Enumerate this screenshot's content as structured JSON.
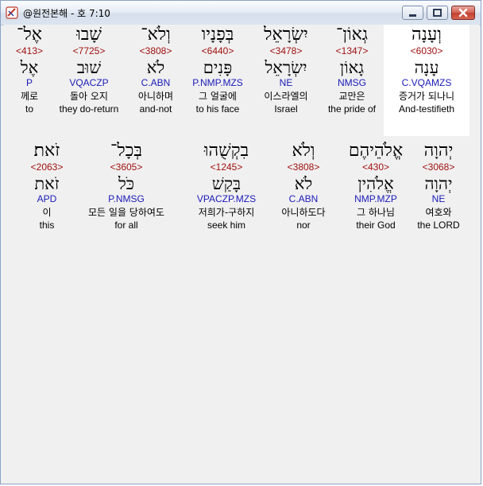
{
  "window": {
    "title": "@원전본해 - 호 7:10",
    "minimize_icon": "minimize-icon",
    "maximize_icon": "maximize-icon",
    "close_icon": "close-icon"
  },
  "rows": [
    {
      "words": [
        {
          "hebrew": "וְעָנָה",
          "strong": "<6030>",
          "lemma": "עָנָה",
          "parse": "C.VQAMZS",
          "korean": "증거가 되나니",
          "english": "And-testifieth",
          "highlight": true
        },
        {
          "hebrew": "גְאוֹן־",
          "strong": "<1347>",
          "lemma": "גָאוֹן",
          "parse": "NMSG",
          "korean": "교만은",
          "english": "the pride of"
        },
        {
          "hebrew": "יִשְׂרָאֵל",
          "strong": "<3478>",
          "lemma": "יִשְׂרָאֵל",
          "parse": "NE",
          "korean": "이스라엘의",
          "english": "Israel"
        },
        {
          "hebrew": "בְּפָנָיו",
          "strong": "<6440>",
          "lemma": "פָּנִים",
          "parse": "P.NMP.MZS",
          "korean": "그 얼굴에",
          "english": "to his face"
        },
        {
          "hebrew": "וְלֹא־",
          "strong": "<3808>",
          "lemma": "לֹא",
          "parse": "C.ABN",
          "korean": "아니하며",
          "english": "and-not"
        },
        {
          "hebrew": "שָׁבוּ",
          "strong": "<7725>",
          "lemma": "שׁוּב",
          "parse": "VQACZP",
          "korean": "돌아 오지",
          "english": "they do-return"
        },
        {
          "hebrew": "אֶל־",
          "strong": "<413>",
          "lemma": "אֶל",
          "parse": "P",
          "korean": "께로",
          "english": "to"
        }
      ]
    },
    {
      "words": [
        {
          "hebrew": "יְהוָה",
          "strong": "<3068>",
          "lemma": "יְהוָה",
          "parse": "NE",
          "korean": "여호와",
          "english": "the LORD"
        },
        {
          "hebrew": "אֱלֹהֵיהֶם",
          "strong": "<430>",
          "lemma": "אֱלֹהִין",
          "parse": "NMP.MZP",
          "korean": "그 하나님",
          "english": "their God"
        },
        {
          "hebrew": "וְלֹא",
          "strong": "<3808>",
          "lemma": "לֹא",
          "parse": "C.ABN",
          "korean": "아니하도다",
          "english": "nor"
        },
        {
          "hebrew": "בִקְשֻׁהוּ",
          "strong": "<1245>",
          "lemma": "בָּקַשׁ",
          "parse": "VPACZP.MZS",
          "korean": "저희가-구하지",
          "english": "seek him"
        },
        {
          "hebrew": "בְּכָל־",
          "strong": "<3605>",
          "lemma": "כֹּל",
          "parse": "P.NMSG",
          "korean": "모든 일을 당하여도",
          "english": "for all"
        },
        {
          "hebrew": "זֹאת׃",
          "strong": "<2063>",
          "lemma": "זֹאת",
          "parse": "APD",
          "korean": "이",
          "english": "this"
        }
      ]
    }
  ]
}
